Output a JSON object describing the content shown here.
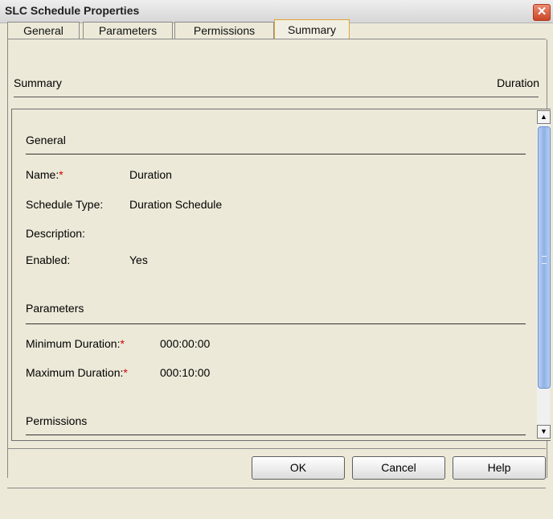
{
  "window": {
    "title": "SLC Schedule Properties",
    "close_glyph": "✕"
  },
  "tabs": [
    {
      "label": "General"
    },
    {
      "label": "Parameters"
    },
    {
      "label": "Permissions"
    },
    {
      "label": "Summary",
      "active": true
    }
  ],
  "header": {
    "left": "Summary",
    "right": "Duration"
  },
  "summary": {
    "general": {
      "title": "General",
      "name_label": "Name:",
      "name_value": "Duration",
      "type_label": "Schedule Type:",
      "type_value": "Duration Schedule",
      "description_label": "Description:",
      "description_value": "",
      "enabled_label": "Enabled:",
      "enabled_value": "Yes"
    },
    "parameters": {
      "title": "Parameters",
      "min_label": "Minimum Duration:",
      "min_value": "000:00:00",
      "max_label": "Maximum Duration:",
      "max_value": "000:10:00"
    },
    "permissions": {
      "title": "Permissions"
    },
    "required_marker": "*"
  },
  "scrollbar": {
    "up_icon": "▲",
    "down_icon": "▼"
  },
  "buttons": {
    "ok": "OK",
    "cancel": "Cancel",
    "help": "Help"
  },
  "colors": {
    "required": "#d20000",
    "active_tab_border": "#e0a238",
    "scroll_thumb": "#8fb1e6"
  }
}
